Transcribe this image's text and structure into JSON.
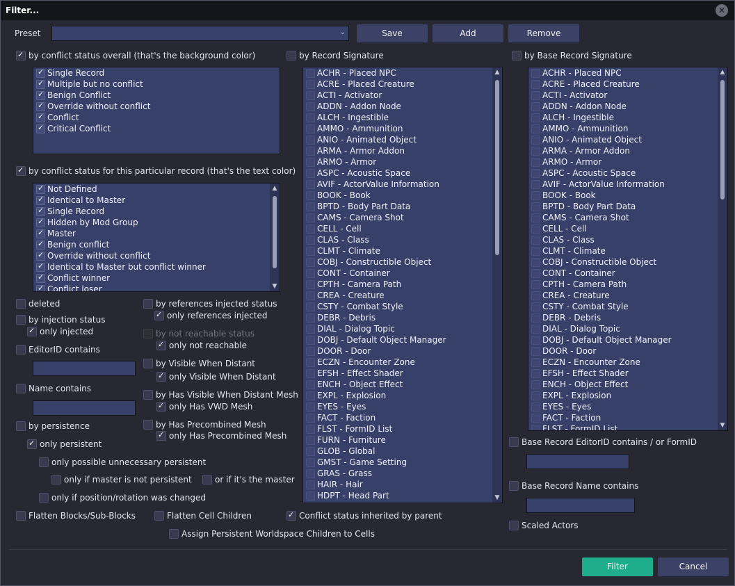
{
  "window": {
    "title": "Filter..."
  },
  "preset": {
    "label": "Preset",
    "value": ""
  },
  "buttons": {
    "save": "Save",
    "add": "Add",
    "remove": "Remove",
    "filter": "Filter",
    "cancel": "Cancel"
  },
  "overall": {
    "label": "by conflict status overall (that's the background color)",
    "checked": true,
    "items": [
      "Single Record",
      "Multiple but no conflict",
      "Benign Conflict",
      "Override without conflict",
      "Conflict",
      "Critical Conflict"
    ]
  },
  "particular": {
    "label": "by conflict status for this particular record  (that's the text color)",
    "checked": true,
    "items": [
      "Not Defined",
      "Identical to Master",
      "Single Record",
      "Hidden by Mod Group",
      "Master",
      "Benign conflict",
      "Override without conflict",
      "Identical to Master but conflict winner",
      "Conflict winner",
      "Conflict loser"
    ]
  },
  "options": {
    "deleted": "deleted",
    "injection": "by injection status",
    "only_injected": "only injected",
    "editorid": "EditorID contains",
    "name": "Name contains",
    "persistence": "by persistence",
    "only_persistent": "only persistent",
    "only_possible_unnecessary": "only possible unnecessary persistent",
    "only_if_master_not_persistent": "only if master is not persistent",
    "or_if_master": "or if it's the master",
    "only_if_position_changed": "only if position/rotation was changed",
    "refs_injected": "by references injected status",
    "only_refs_injected": "only references injected",
    "not_reachable": "by not reachable status",
    "only_not_reachable": "only not reachable",
    "visible_distant": "by Visible When Distant",
    "only_visible_distant": "only Visible When Distant",
    "vwd_mesh": "by Has Visible When Distant Mesh",
    "only_vwd_mesh": "only Has VWD Mesh",
    "precombined": "by Has Precombined Mesh",
    "only_precombined": "only Has Precombined Mesh",
    "flatten_blocks": "Flatten Blocks/Sub-Blocks",
    "flatten_cell": "Flatten Cell Children",
    "conflict_inherited": "Conflict status inherited by parent",
    "assign_persistent": "Assign Persistent Worldspace Children to Cells",
    "base_editorid": "Base Record EditorID contains / or FormID",
    "base_name": "Base Record Name contains",
    "scaled_actors": "Scaled Actors"
  },
  "record_signature": {
    "label": "by Record Signature",
    "items": [
      "ACHR - Placed NPC",
      "ACRE - Placed Creature",
      "ACTI - Activator",
      "ADDN - Addon Node",
      "ALCH - Ingestible",
      "AMMO - Ammunition",
      "ANIO - Animated Object",
      "ARMA - Armor Addon",
      "ARMO - Armor",
      "ASPC - Acoustic Space",
      "AVIF - ActorValue Information",
      "BOOK - Book",
      "BPTD - Body Part Data",
      "CAMS - Camera Shot",
      "CELL - Cell",
      "CLAS - Class",
      "CLMT - Climate",
      "COBJ - Constructible Object",
      "CONT - Container",
      "CPTH - Camera Path",
      "CREA - Creature",
      "CSTY - Combat Style",
      "DEBR - Debris",
      "DIAL - Dialog Topic",
      "DOBJ - Default Object Manager",
      "DOOR - Door",
      "ECZN - Encounter Zone",
      "EFSH - Effect Shader",
      "ENCH - Object Effect",
      "EXPL - Explosion",
      "EYES - Eyes",
      "FACT - Faction",
      "FLST - FormID List",
      "FURN - Furniture",
      "GLOB - Global",
      "GMST - Game Setting",
      "GRAS - Grass",
      "HAIR - Hair",
      "HDPT - Head Part"
    ]
  },
  "base_signature": {
    "label": "by Base Record Signature",
    "items": [
      "ACHR - Placed NPC",
      "ACRE - Placed Creature",
      "ACTI - Activator",
      "ADDN - Addon Node",
      "ALCH - Ingestible",
      "AMMO - Ammunition",
      "ANIO - Animated Object",
      "ARMA - Armor Addon",
      "ARMO - Armor",
      "ASPC - Acoustic Space",
      "AVIF - ActorValue Information",
      "BOOK - Book",
      "BPTD - Body Part Data",
      "CAMS - Camera Shot",
      "CELL - Cell",
      "CLAS - Class",
      "CLMT - Climate",
      "COBJ - Constructible Object",
      "CONT - Container",
      "CPTH - Camera Path",
      "CREA - Creature",
      "CSTY - Combat Style",
      "DEBR - Debris",
      "DIAL - Dialog Topic",
      "DOBJ - Default Object Manager",
      "DOOR - Door",
      "ECZN - Encounter Zone",
      "EFSH - Effect Shader",
      "ENCH - Object Effect",
      "EXPL - Explosion",
      "EYES - Eyes",
      "FACT - Faction",
      "FLST - FormID List"
    ]
  },
  "colors": {
    "accent": "#1fae8c",
    "list_bg": "#374069",
    "button": "#3b4266"
  }
}
